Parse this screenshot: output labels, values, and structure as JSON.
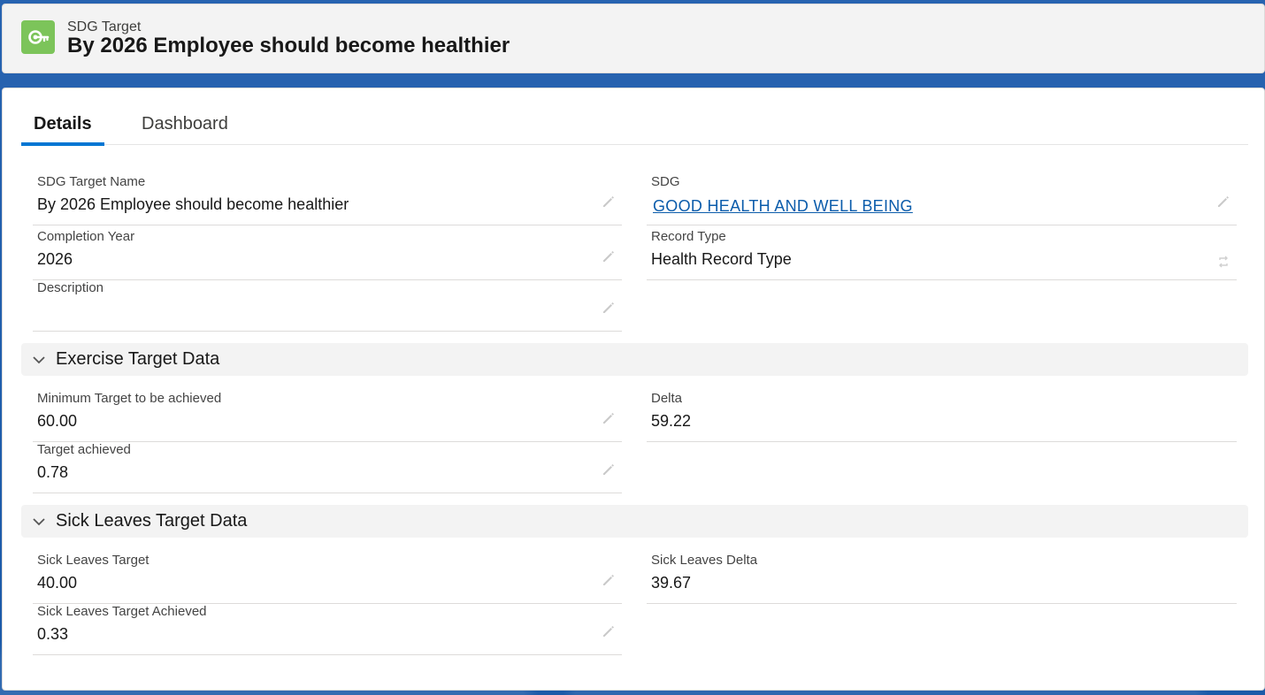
{
  "header": {
    "object_type": "SDG Target",
    "title": "By 2026 Employee should become healthier",
    "icon": "target-icon",
    "icon_color": "#7cc45a"
  },
  "tabs": [
    {
      "label": "Details",
      "active": true
    },
    {
      "label": "Dashboard",
      "active": false
    }
  ],
  "fields": {
    "sdg_target_name": {
      "label": "SDG Target Name",
      "value": "By 2026 Employee should become healthier"
    },
    "sdg": {
      "label": "SDG",
      "value": "GOOD HEALTH AND WELL BEING"
    },
    "completion_year": {
      "label": "Completion Year",
      "value": "2026"
    },
    "record_type": {
      "label": "Record Type",
      "value": "Health Record Type"
    },
    "description": {
      "label": "Description",
      "value": ""
    }
  },
  "sections": {
    "exercise": {
      "title": "Exercise Target Data",
      "fields": {
        "minimum_target": {
          "label": "Minimum Target to be achieved",
          "value": "60.00"
        },
        "delta": {
          "label": "Delta",
          "value": "59.22"
        },
        "target_achieved": {
          "label": "Target achieved",
          "value": "0.78"
        }
      }
    },
    "sick_leaves": {
      "title": "Sick Leaves Target Data",
      "fields": {
        "target": {
          "label": "Sick Leaves Target",
          "value": "40.00"
        },
        "delta": {
          "label": "Sick Leaves Delta",
          "value": "39.67"
        },
        "target_achieved": {
          "label": "Sick Leaves Target Achieved",
          "value": "0.33"
        }
      }
    }
  },
  "colors": {
    "accent": "#0176d3",
    "link": "#0b5cab",
    "background": "#1d5aa6"
  }
}
